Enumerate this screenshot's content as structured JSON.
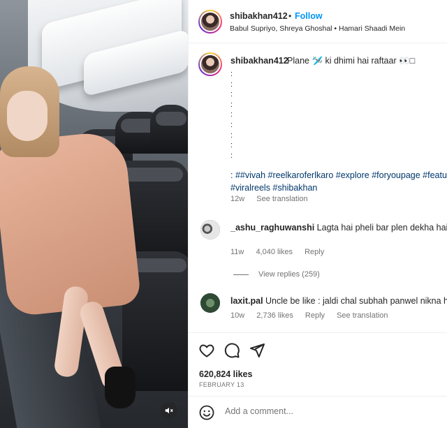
{
  "post": {
    "username": "shibakhan412",
    "follow_label": "Follow",
    "separator": "•",
    "audio": "Babul Supriyo, Shreya Ghoshal • Hamari Shaadi Mein"
  },
  "caption": {
    "username": "shibakhan412",
    "text": "Plane 🛩️ ki dhimi hai raftaar 👀□",
    "colon_lines": ":\n:\n:\n:\n:\n:\n:\n:\n:",
    "hashtags_line1": ": ##vivah #reelkaroferlkaro #explore #foryoupage #featu",
    "hashtags_line2": "#viralreels #shibakhan",
    "time": "12w",
    "see_translation": "See translation"
  },
  "comments": [
    {
      "username": "_ashu_raghuwanshi",
      "text": "Lagta hai pheli bar plen dekha hai 😅",
      "time": "11w",
      "likes": "4,040 likes",
      "reply_label": "Reply",
      "view_replies": "View replies (259)"
    },
    {
      "username": "laxit.pal",
      "text": "Uncle be like : jaldi chal subhah panwel nikna h",
      "time": "10w",
      "likes": "2,736 likes",
      "reply_label": "Reply",
      "see_translation": "See translation"
    }
  ],
  "engagement": {
    "likes": "620,824 likes",
    "date": "FEBRUARY 13"
  },
  "composer": {
    "placeholder": "Add a comment..."
  },
  "icons": {
    "like": "heart-icon",
    "comment": "comment-bubble-icon",
    "share": "paper-plane-icon",
    "emoji": "smiley-icon",
    "mute": "speaker-muted-icon"
  },
  "colors": {
    "follow": "#0095f6",
    "hashtag": "#00376b",
    "muted_text": "#737373"
  }
}
